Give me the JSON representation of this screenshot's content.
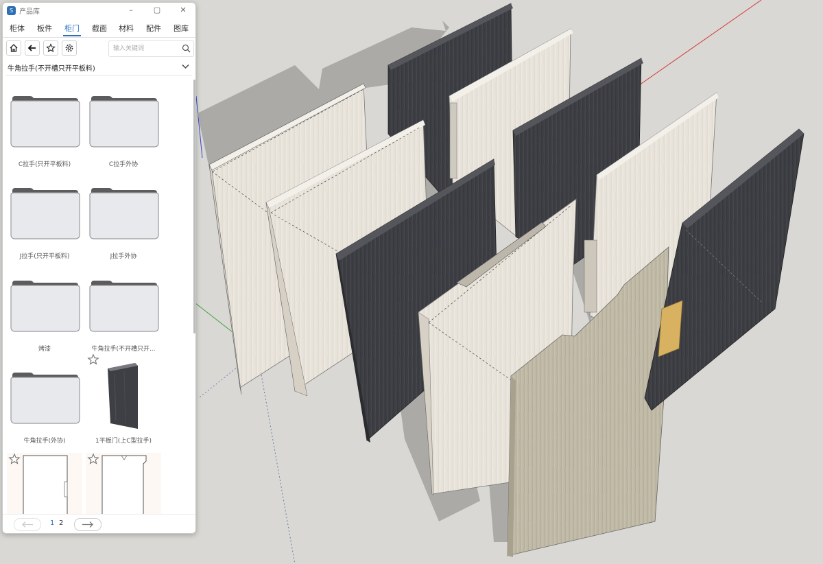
{
  "window": {
    "title": "产品库",
    "minimize": "–",
    "maximize": "▢",
    "close": "✕"
  },
  "tabs": [
    {
      "label": "柜体"
    },
    {
      "label": "板件"
    },
    {
      "label": "柜门"
    },
    {
      "label": "截面"
    },
    {
      "label": "材料"
    },
    {
      "label": "配件"
    },
    {
      "label": "图库"
    }
  ],
  "active_tab": "柜门",
  "toolbar": {
    "home": "home-icon",
    "back": "back-arrow-icon",
    "favorite": "star-icon",
    "settings": "gear-icon"
  },
  "search": {
    "placeholder": "输入关键词",
    "value": ""
  },
  "category": {
    "selected": "牛角拉手(不开槽只开平板料)"
  },
  "items": [
    {
      "label": "C拉手(只开平板料)",
      "kind": "folder"
    },
    {
      "label": "C拉手外协",
      "kind": "folder"
    },
    {
      "label": "J拉手(只开平板料)",
      "kind": "folder"
    },
    {
      "label": "J拉手外协",
      "kind": "folder"
    },
    {
      "label": "烤漆",
      "kind": "folder"
    },
    {
      "label": "牛角拉手(不开槽只开...",
      "kind": "folder"
    },
    {
      "label": "牛角拉手(外协)",
      "kind": "folder"
    },
    {
      "label": "1平板门(上C型拉手)",
      "kind": "thumbnail-dark-door"
    },
    {
      "label": "",
      "kind": "thumbnail-door-outline"
    },
    {
      "label": "",
      "kind": "thumbnail-door-notch"
    }
  ],
  "pagination": {
    "prev": "←",
    "next": "→",
    "pages": [
      "1",
      "2"
    ],
    "current": "1"
  },
  "colors": {
    "accent": "#2b6fbf",
    "dark_wood": "#3e3f44",
    "light_wood": "#e8e3da",
    "oak": "#bdb8a4",
    "gold": "#d8b260"
  }
}
